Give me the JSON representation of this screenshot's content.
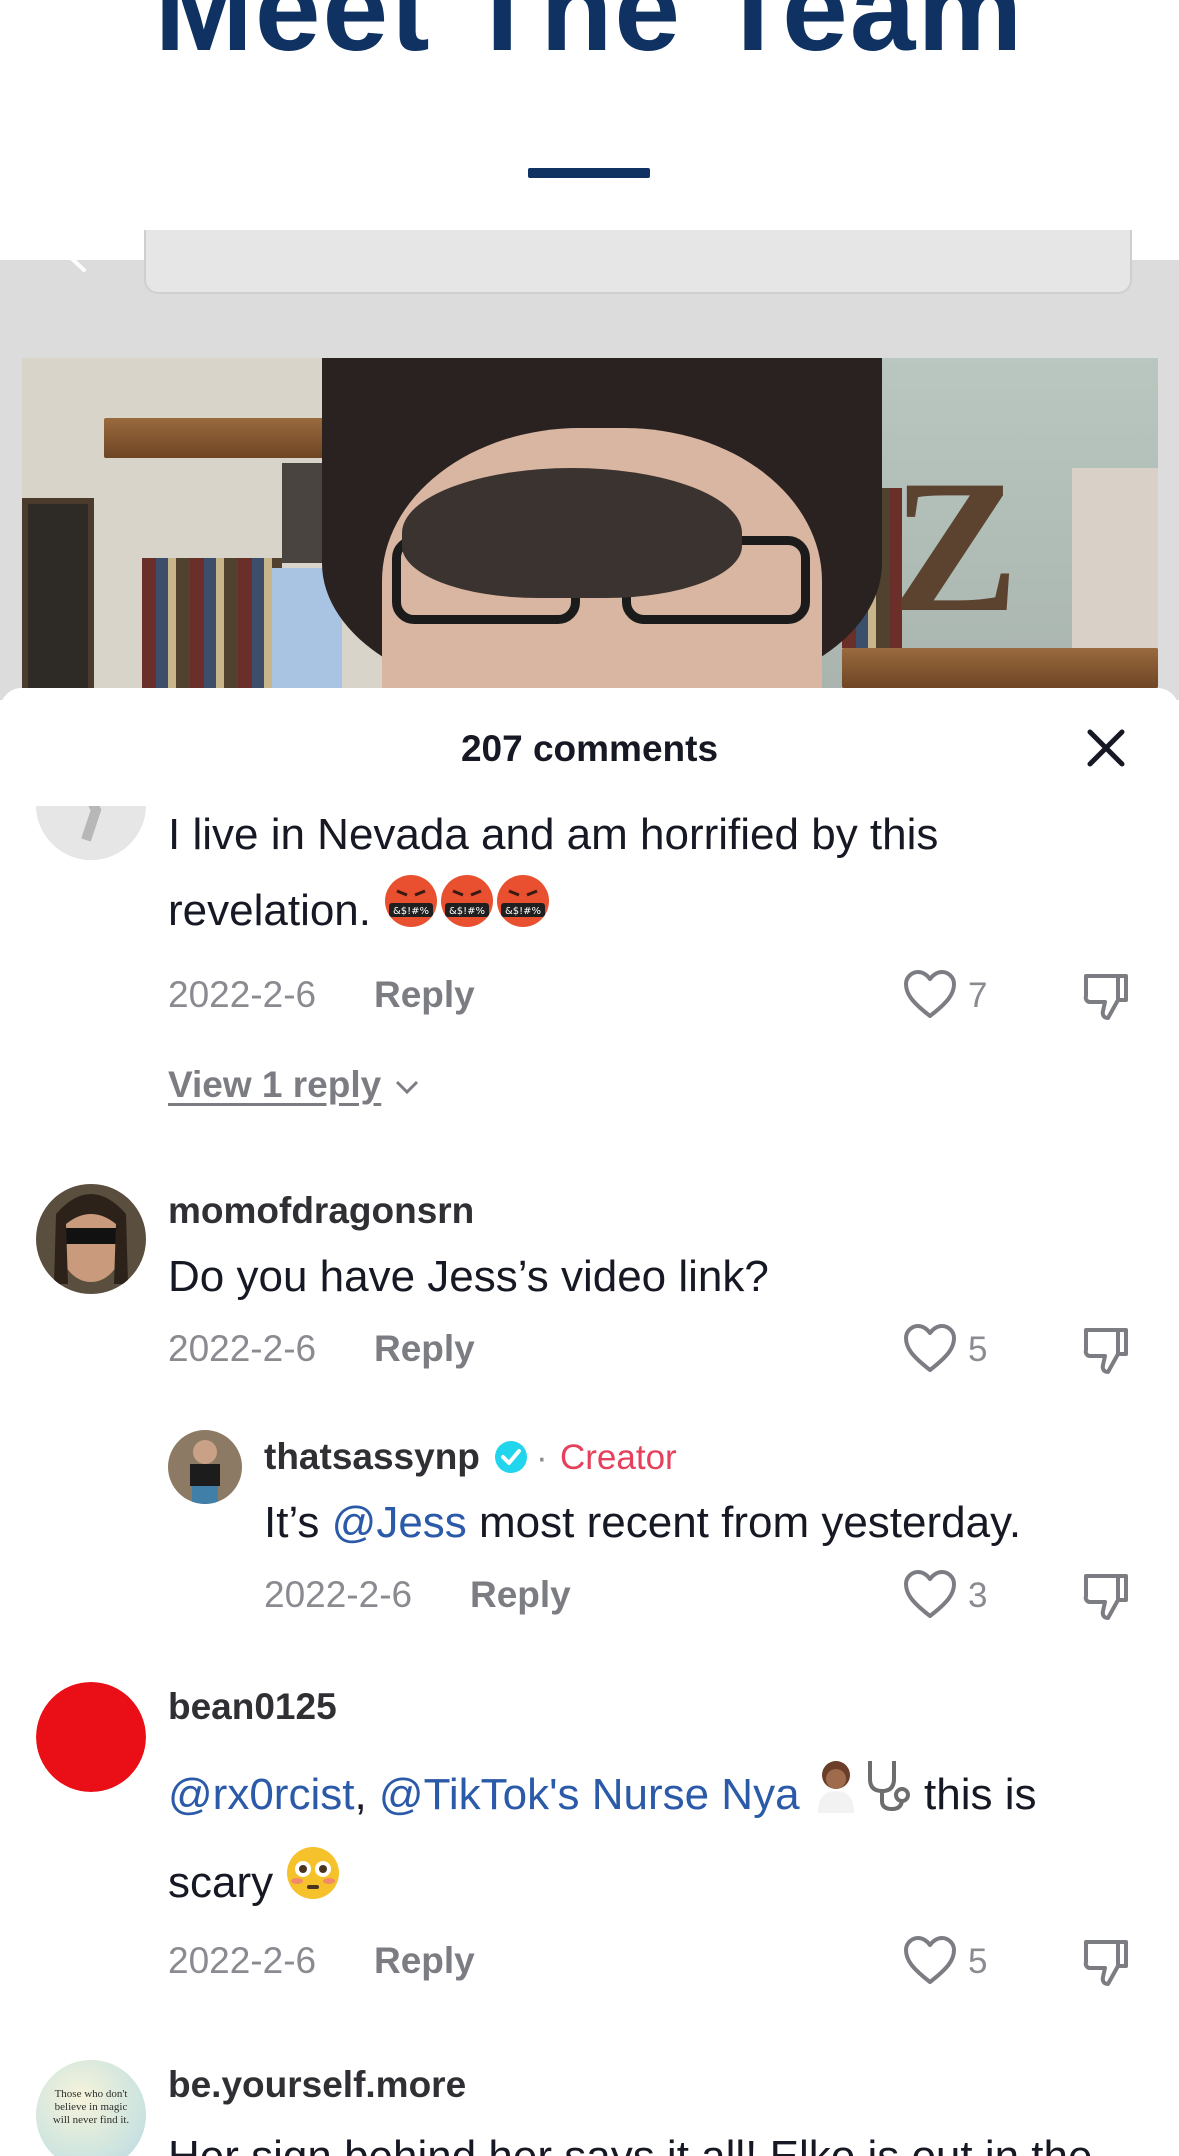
{
  "banner": {
    "title": "Meet The Team"
  },
  "sheet": {
    "count_label": "207 comments"
  },
  "comments": [
    {
      "username": "",
      "text_line1": "I live in Nevada and am horrified by this",
      "text_line2": "revelation.",
      "emoji": [
        "angry-censored-face",
        "angry-censored-face",
        "angry-censored-face"
      ],
      "date": "2022-2-6",
      "reply_label": "Reply",
      "likes": "7",
      "view_replies": "View 1 reply"
    },
    {
      "username": "momofdragonsrn",
      "text": "Do you have Jess’s video link?",
      "date": "2022-2-6",
      "reply_label": "Reply",
      "likes": "5",
      "reply": {
        "username": "thatsassynp",
        "separator": "·",
        "badge": "Creator",
        "text_prefix": "It’s ",
        "mention": "@Jess",
        "text_suffix": " most recent from yesterday.",
        "date": "2022-2-6",
        "reply_label": "Reply",
        "likes": "3"
      }
    },
    {
      "username": "bean0125",
      "mention1": "@rx0rcist",
      "comma": ",",
      "mention2": "@TikTok's Nurse Nya",
      "emoji": [
        "woman-health-worker",
        "stethoscope"
      ],
      "text_suffix": " this is",
      "text_line2": "scary",
      "emoji2": "flushed-face",
      "date": "2022-2-6",
      "reply_label": "Reply",
      "likes": "5"
    },
    {
      "username": "be.yourself.more",
      "avatar_text": "Those who don't believe in magic will never find it.",
      "text": "Her sign behind her says it all! Elko is out in the"
    }
  ],
  "colors": {
    "mention": "#2b5aa8",
    "creator_badge": "#e5415c",
    "verified": "#20d5ec",
    "banner_text": "#0f3262"
  }
}
